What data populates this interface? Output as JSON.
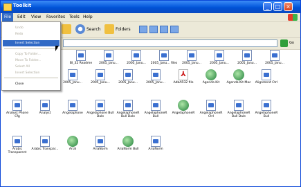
{
  "window": {
    "title": "Toolkit"
  },
  "menu": [
    "File",
    "Edit",
    "View",
    "Favorites",
    "Tools",
    "Help"
  ],
  "toolbar": {
    "search_label": "Search",
    "folders_label": "Folders"
  },
  "address": {
    "go_label": "Go"
  },
  "dropdown": {
    "items": [
      "Undo",
      "Redo",
      "Invert Selection",
      "Copy To Folder...",
      "Move To Folder...",
      "Select All",
      "Invert Selection",
      "Close"
    ],
    "highlighted_index": 2
  },
  "icons": [
    {
      "label": "BI_32 Readme",
      "type": "doc"
    },
    {
      "label": "2005_Janu...",
      "type": "doc"
    },
    {
      "label": "2005_Janu...",
      "type": "doc"
    },
    {
      "label": "2005_Janu... files",
      "type": "doc"
    },
    {
      "label": "2005_Janu...",
      "type": "doc"
    },
    {
      "label": "2005_Janu...",
      "type": "doc"
    },
    {
      "label": "2005_Janu...",
      "type": "doc"
    },
    {
      "label": "2005_Janu...",
      "type": "doc"
    },
    {
      "label": "2005_Janu...",
      "type": "doc"
    },
    {
      "label": "2005_Janu...",
      "type": "doc"
    },
    {
      "label": "2005_Janu...",
      "type": "doc"
    },
    {
      "label": "2005_Janu...",
      "type": "doc"
    },
    {
      "label": "2005_Janu...",
      "type": "doc"
    },
    {
      "label": "2005_Janu...",
      "type": "doc"
    },
    {
      "label": "AdbAR32 file",
      "type": "pdf"
    },
    {
      "label": "Agenda Kit",
      "type": "ie"
    },
    {
      "label": "Agenda Kit Mac",
      "type": "ie"
    },
    {
      "label": "Alignment Ctrl",
      "type": "doc"
    },
    {
      "label": "Analyst Phone Cfg",
      "type": "doc"
    },
    {
      "label": "Analyst",
      "type": "doc"
    },
    {
      "label": "Angelaphone",
      "type": "doc"
    },
    {
      "label": "Angelaphone Bull Dale",
      "type": "doc"
    },
    {
      "label": "AngelaphoneR Bull Dale",
      "type": "doc"
    },
    {
      "label": "AngelaphoneR Bull",
      "type": "doc"
    },
    {
      "label": "AngelaphoneR",
      "type": "ie"
    },
    {
      "label": "AngelaphoneR Ctrl",
      "type": "doc"
    },
    {
      "label": "AngelaphoneR Bull Dale",
      "type": "doc"
    },
    {
      "label": "AngelaphoneR Bull",
      "type": "doc"
    },
    {
      "label": "Arabic Transparent",
      "type": "doc"
    },
    {
      "label": "Arabic Transpar...",
      "type": "doc"
    },
    {
      "label": "Arial",
      "type": "ie"
    },
    {
      "label": "AriaNorm",
      "type": "doc"
    },
    {
      "label": "AriaNorm Bull",
      "type": "ie"
    },
    {
      "label": "AriaNorm",
      "type": "doc"
    }
  ]
}
